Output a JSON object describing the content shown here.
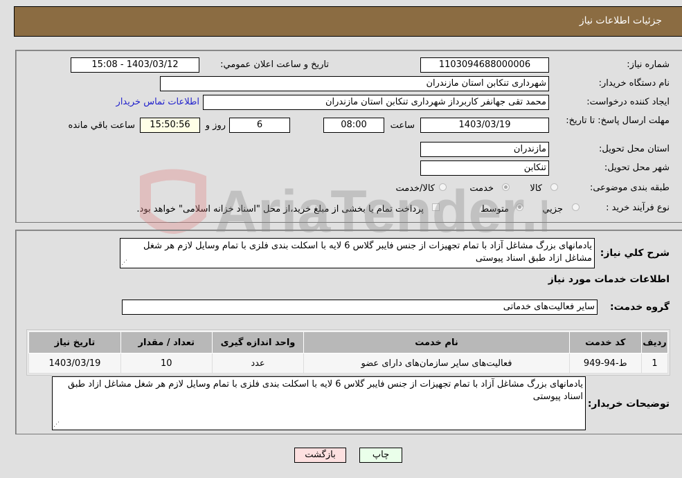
{
  "header": {
    "title": "جزئیات اطلاعات نیاز"
  },
  "fields": {
    "need_number_label": "شماره نیاز:",
    "need_number": "1103094688000006",
    "announce_label": "تاریخ و ساعت اعلان عمومي:",
    "announce_value": "1403/03/12 - 15:08",
    "buyer_org_label": "نام دستگاه خریدار:",
    "buyer_org": "شهرداری تنکابن استان مازندران",
    "creator_label": "ایجاد کننده درخواست:",
    "creator": "محمد تقی جهانفر کاربرداز شهرداری تنکابن استان مازندران",
    "buyer_contact_link": "اطلاعات تماس خریدار",
    "deadline_label": "مهلت ارسال پاسخ: تا تاریخ:",
    "deadline_date": "1403/03/19",
    "time_label": "ساعت",
    "deadline_time": "08:00",
    "days_value": "6",
    "days_label": "روز و",
    "remaining_time": "15:50:56",
    "remaining_label": "ساعت باقي مانده",
    "province_label": "استان محل تحویل:",
    "province": "مازندران",
    "city_label": "شهر محل تحویل:",
    "city": "تنکابن",
    "category_label": "طبقه بندی موضوعی:",
    "category_options": [
      "کالا",
      "خدمت",
      "کالا/خدمت"
    ],
    "category_selected": "خدمت",
    "process_label": "نوع فرآیند خرید :",
    "process_options": [
      "جزيي",
      "متوسط"
    ],
    "process_selected": "متوسط",
    "treasury_note": "پرداخت تمام یا بخشی از مبلغ خرید،از محل \"اسناد خزانه اسلامی\" خواهد بود."
  },
  "description": {
    "label": "شرح کلي نیاز:",
    "text": "یادمانهای بزرگ مشاغل آزاد با تمام تجهیزات از جنس فایبر گلاس 6 لایه با اسکلت بندی فلزی  با تمام وسایل لازم هر شغل مشاغل ازاد طبق اسناد پیوستی"
  },
  "services_section": {
    "title": "اطلاعات خدمات مورد نیاز",
    "group_label": "گروه خدمت:",
    "group_value": "سایر فعالیت‌های خدماتی"
  },
  "table": {
    "headers": [
      "ردیف",
      "کد خدمت",
      "نام خدمت",
      "واحد اندازه گیری",
      "تعداد / مقدار",
      "تاریخ نیاز"
    ],
    "rows": [
      [
        "1",
        "ط-94-949",
        "فعالیت‌های سایر سازمان‌های دارای عضو",
        "عدد",
        "10",
        "1403/03/19"
      ]
    ]
  },
  "buyer_notes": {
    "label": "توضیحات خریدار:",
    "text": "یادمانهای بزرگ مشاغل آزاد با تمام تجهیزات از جنس فایبر گلاس 6 لایه با اسکلت بندی فلزی  با تمام وسایل لازم هر شغل مشاغل ازاد طبق اسناد پیوستی"
  },
  "buttons": {
    "print": "چاپ",
    "back": "بازگشت"
  },
  "watermark": {
    "text": "AriaTender.neT"
  },
  "colors": {
    "header_bg": "#8b6c42",
    "link": "#2222cc",
    "back_btn": "#fde0e0",
    "print_btn": "#eaffea"
  }
}
